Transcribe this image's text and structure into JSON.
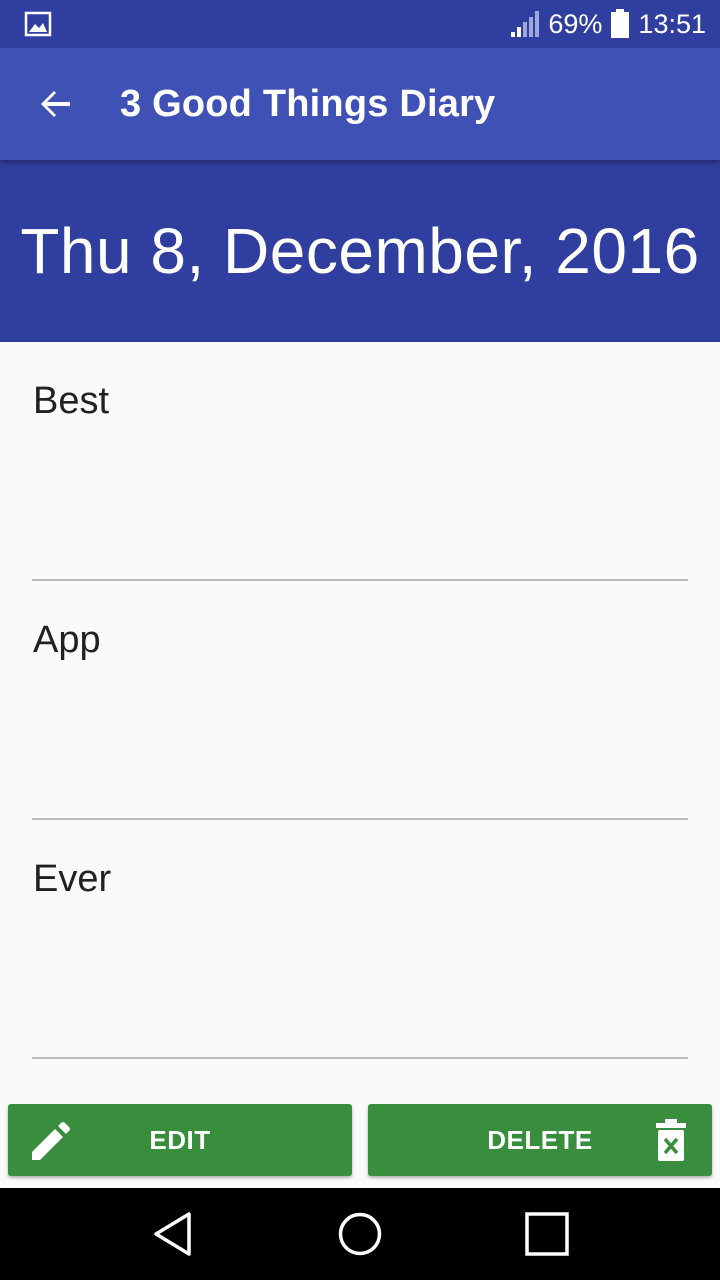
{
  "status_bar": {
    "battery_percent": "69%",
    "time": "13:51",
    "icons": [
      "gallery-icon",
      "signal-icon",
      "battery-icon"
    ]
  },
  "app_bar": {
    "title": "3 Good Things Diary",
    "back_icon": "arrow-back-icon"
  },
  "date_header": {
    "date": "Thu 8, December, 2016"
  },
  "entries": [
    {
      "text": "Best"
    },
    {
      "text": "App"
    },
    {
      "text": "Ever"
    }
  ],
  "actions": {
    "edit_label": "EDIT",
    "delete_label": "DELETE",
    "edit_icon": "pencil-icon",
    "delete_icon": "trash-icon"
  },
  "nav_bar": {
    "icons": [
      "back-triangle-icon",
      "home-circle-icon",
      "recents-square-icon"
    ]
  },
  "colors": {
    "primary": "#3f51b5",
    "primary_dark": "#303f9f",
    "button_green": "#388e3c",
    "background": "#fafafa"
  }
}
